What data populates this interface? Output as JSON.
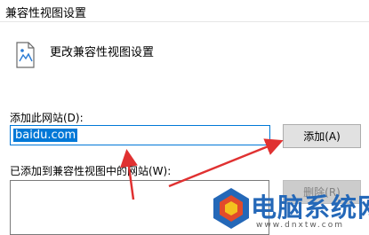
{
  "window": {
    "title": "兼容性视图设置"
  },
  "header": {
    "text": "更改兼容性视图设置",
    "icon": "settings-page-icon"
  },
  "add_site": {
    "label": "添加此网站(D):",
    "value": "baidu.com",
    "button": "添加(A)"
  },
  "sites_list": {
    "label": "已添加到兼容性视图中的网站(W):",
    "items": [],
    "remove_button": "删除(R)"
  },
  "watermark": {
    "name": "电脑系统网",
    "url": "www.dnxtw.com"
  },
  "colors": {
    "accent": "#0078d7",
    "annotation": "#e03131",
    "watermark": "#2468b8"
  }
}
